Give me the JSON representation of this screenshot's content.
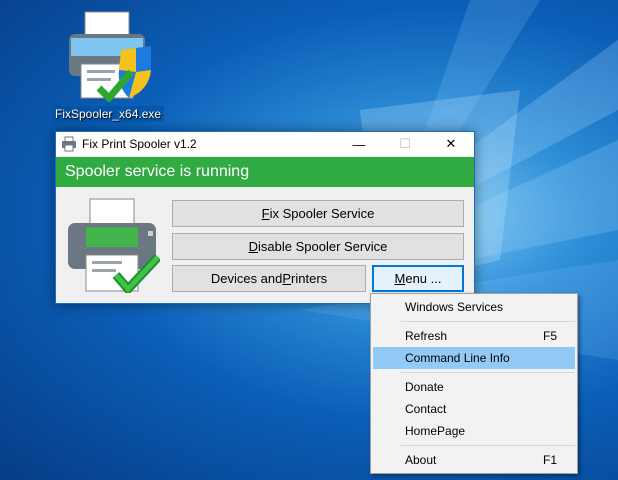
{
  "desktop": {
    "icon_label": "FixSpooler_x64.exe",
    "icon_name": "fixspooler-printer-icon"
  },
  "window": {
    "title": "Fix Print Spooler v1.2",
    "controls": {
      "minimize": "—",
      "maximize": "☐",
      "close": "✕"
    },
    "status_text": "Spooler service is running",
    "status_color": "#2fab42",
    "buttons": {
      "fix": {
        "ul": "F",
        "rest": "ix Spooler Service"
      },
      "disable": {
        "ul": "D",
        "rest": "isable Spooler Service"
      },
      "devices": {
        "pre": "Devices and ",
        "ul": "P",
        "rest": "rinters"
      },
      "menu": {
        "ul": "M",
        "rest": "enu ..."
      }
    }
  },
  "menu": {
    "items": [
      {
        "label": "Windows Services",
        "shortcut": ""
      },
      {
        "label": "Refresh",
        "shortcut": "F5"
      },
      {
        "label": "Command Line Info",
        "shortcut": "",
        "highlighted": true
      },
      {
        "label": "Donate",
        "shortcut": ""
      },
      {
        "label": "Contact",
        "shortcut": ""
      },
      {
        "label": "HomePage",
        "shortcut": ""
      },
      {
        "label": "About",
        "shortcut": "F1"
      }
    ]
  }
}
